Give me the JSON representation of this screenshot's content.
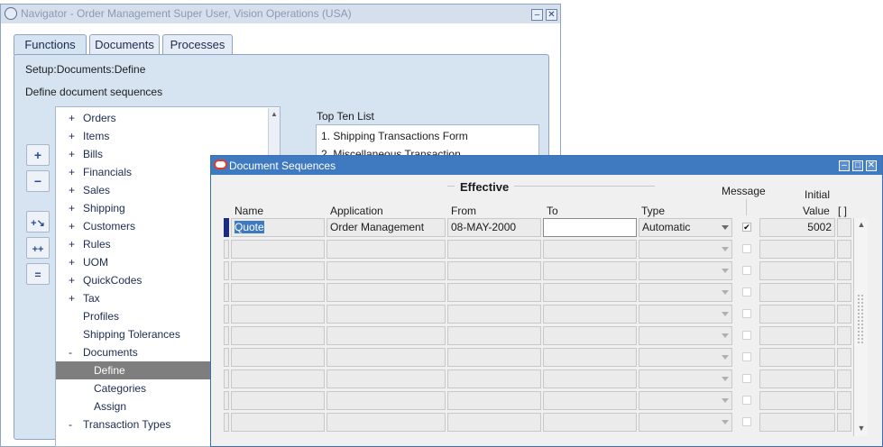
{
  "navigator": {
    "title": "Navigator - Order Management Super User, Vision Operations (USA)",
    "tabs": [
      "Functions",
      "Documents",
      "Processes"
    ],
    "active_tab": "Functions",
    "path": "Setup:Documents:Define",
    "description": "Define document sequences",
    "side_buttons": [
      "plus-icon",
      "minus-icon",
      "expand-branch-icon",
      "expand-all-icon",
      "collapse-all-icon"
    ],
    "tree": [
      {
        "prefix": "+",
        "label": "Orders",
        "level": 0
      },
      {
        "prefix": "+",
        "label": "Items",
        "level": 0
      },
      {
        "prefix": "+",
        "label": "Bills",
        "level": 0
      },
      {
        "prefix": "+",
        "label": "Financials",
        "level": 0
      },
      {
        "prefix": "+",
        "label": "Sales",
        "level": 0
      },
      {
        "prefix": "+",
        "label": "Shipping",
        "level": 0
      },
      {
        "prefix": "+",
        "label": "Customers",
        "level": 0
      },
      {
        "prefix": "+",
        "label": "Rules",
        "level": 0
      },
      {
        "prefix": "+",
        "label": "UOM",
        "level": 0
      },
      {
        "prefix": "+",
        "label": "QuickCodes",
        "level": 0
      },
      {
        "prefix": "+",
        "label": "Tax",
        "level": 0
      },
      {
        "prefix": "",
        "label": "Profiles",
        "level": 0
      },
      {
        "prefix": "",
        "label": "Shipping Tolerances",
        "level": 0
      },
      {
        "prefix": "-",
        "label": "Documents",
        "level": 0
      },
      {
        "prefix": "",
        "label": "Define",
        "level": 1,
        "selected": true
      },
      {
        "prefix": "",
        "label": "Categories",
        "level": 1
      },
      {
        "prefix": "",
        "label": "Assign",
        "level": 1
      },
      {
        "prefix": "-",
        "label": "Transaction Types",
        "level": 0
      }
    ],
    "top_ten": {
      "label": "Top Ten List",
      "items": [
        "1. Shipping Transactions Form",
        "2. Miscellaneous Transaction"
      ]
    }
  },
  "doc_seq": {
    "title": "Document Sequences",
    "group_label": "Effective",
    "headers": {
      "name": "Name",
      "application": "Application",
      "from": "From",
      "to": "To",
      "type": "Type",
      "message": "Message",
      "initial": "Initial",
      "value": "Value",
      "flex": "[ ]"
    },
    "rows": [
      {
        "name": "Quote",
        "application": "Order Management",
        "from": "08-MAY-2000",
        "to": "",
        "type": "Automatic",
        "message": true,
        "initial_value": "5002"
      },
      {
        "name": "",
        "application": "",
        "from": "",
        "to": "",
        "type": "",
        "message": false,
        "initial_value": ""
      },
      {
        "name": "",
        "application": "",
        "from": "",
        "to": "",
        "type": "",
        "message": false,
        "initial_value": ""
      },
      {
        "name": "",
        "application": "",
        "from": "",
        "to": "",
        "type": "",
        "message": false,
        "initial_value": ""
      },
      {
        "name": "",
        "application": "",
        "from": "",
        "to": "",
        "type": "",
        "message": false,
        "initial_value": ""
      },
      {
        "name": "",
        "application": "",
        "from": "",
        "to": "",
        "type": "",
        "message": false,
        "initial_value": ""
      },
      {
        "name": "",
        "application": "",
        "from": "",
        "to": "",
        "type": "",
        "message": false,
        "initial_value": ""
      },
      {
        "name": "",
        "application": "",
        "from": "",
        "to": "",
        "type": "",
        "message": false,
        "initial_value": ""
      },
      {
        "name": "",
        "application": "",
        "from": "",
        "to": "",
        "type": "",
        "message": false,
        "initial_value": ""
      },
      {
        "name": "",
        "application": "",
        "from": "",
        "to": "",
        "type": "",
        "message": false,
        "initial_value": ""
      }
    ]
  },
  "colors": {
    "title_active": "#3f7ac1",
    "title_inactive": "#d6dfec",
    "selection": "#7e7e7e",
    "record_indicator": "#1c2c80"
  }
}
